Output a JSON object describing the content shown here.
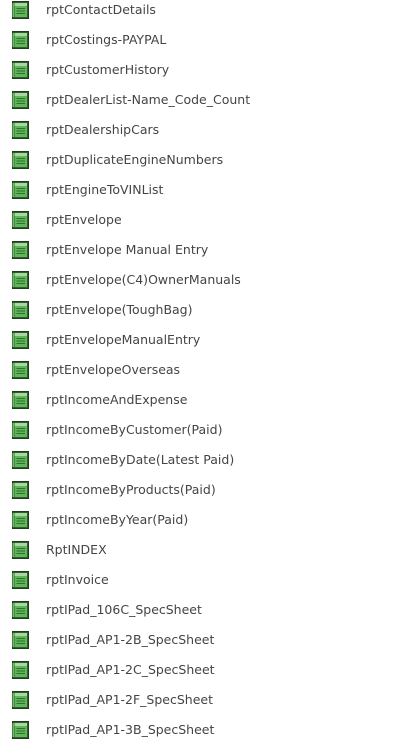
{
  "reports": {
    "icon": "report-icon",
    "colors": {
      "icon_green": "#3f9b3a",
      "icon_dark": "#2f5d2c",
      "text": "#444444"
    },
    "items": [
      {
        "label": "rptContactDetails"
      },
      {
        "label": "rptCostings-PAYPAL"
      },
      {
        "label": "rptCustomerHistory"
      },
      {
        "label": "rptDealerList-Name_Code_Count"
      },
      {
        "label": "rptDealershipCars"
      },
      {
        "label": "rptDuplicateEngineNumbers"
      },
      {
        "label": "rptEngineToVINList"
      },
      {
        "label": "rptEnvelope"
      },
      {
        "label": "rptEnvelope Manual Entry"
      },
      {
        "label": "rptEnvelope(C4)OwnerManuals"
      },
      {
        "label": "rptEnvelope(ToughBag)"
      },
      {
        "label": "rptEnvelopeManualEntry"
      },
      {
        "label": "rptEnvelopeOverseas"
      },
      {
        "label": "rptIncomeAndExpense"
      },
      {
        "label": "rptIncomeByCustomer(Paid)"
      },
      {
        "label": "rptIncomeByDate(Latest Paid)"
      },
      {
        "label": "rptIncomeByProducts(Paid)"
      },
      {
        "label": "rptIncomeByYear(Paid)"
      },
      {
        "label": "RptINDEX"
      },
      {
        "label": "rptInvoice"
      },
      {
        "label": "rptIPad_106C_SpecSheet"
      },
      {
        "label": "rptIPad_AP1-2B_SpecSheet"
      },
      {
        "label": "rptIPad_AP1-2C_SpecSheet"
      },
      {
        "label": "rptIPad_AP1-2F_SpecSheet"
      },
      {
        "label": "rptIPad_AP1-3B_SpecSheet"
      }
    ]
  }
}
